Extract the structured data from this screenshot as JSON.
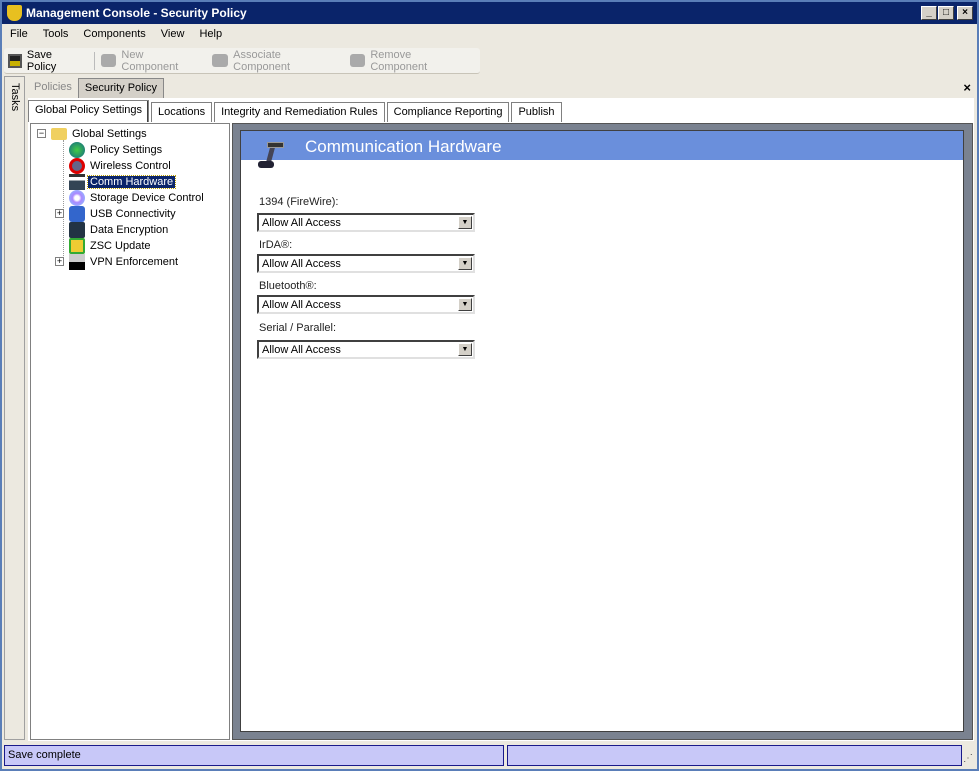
{
  "window": {
    "title": "Management Console - Security Policy"
  },
  "menu": [
    "File",
    "Tools",
    "Components",
    "View",
    "Help"
  ],
  "toolbar": {
    "save": "Save Policy",
    "new": "New Component",
    "associate": "Associate Component",
    "remove": "Remove Component"
  },
  "tasks_label": "Tasks",
  "doc_tabs": [
    "Policies",
    "Security Policy"
  ],
  "sub_tabs": [
    "Global Policy Settings",
    "Locations",
    "Integrity and Remediation Rules",
    "Compliance Reporting",
    "Publish"
  ],
  "tree": {
    "root": "Global Settings",
    "items": [
      "Policy Settings",
      "Wireless Control",
      "Comm Hardware",
      "Storage Device Control",
      "USB Connectivity",
      "Data Encryption",
      "ZSC Update",
      "VPN Enforcement"
    ],
    "selected": "Comm Hardware"
  },
  "panel": {
    "title": "Communication Hardware",
    "fields": [
      {
        "label": "1394 (FireWire):",
        "value": "Allow All Access"
      },
      {
        "label": "IrDA®:",
        "value": "Allow All Access"
      },
      {
        "label": "Bluetooth®:",
        "value": "Allow All Access"
      },
      {
        "label": "Serial / Parallel:",
        "value": "Allow All Access"
      }
    ]
  },
  "status": {
    "text": "Save complete",
    "right": ""
  },
  "colors": {
    "titlebar": "#0a246a",
    "header": "#6a8fdc",
    "status": "#c8c8f8"
  }
}
